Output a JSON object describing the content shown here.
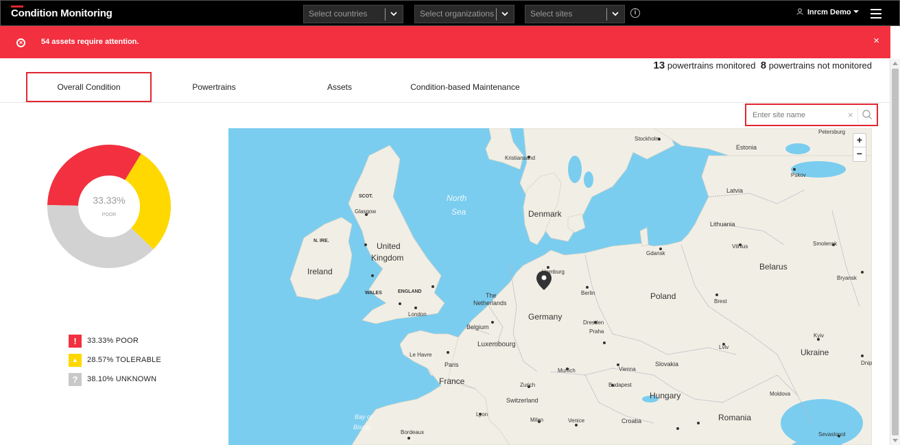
{
  "app": {
    "title": "Condition Monitoring"
  },
  "filters": {
    "countries_placeholder": "Select countries",
    "organizations_placeholder": "Select organizations",
    "sites_placeholder": "Select sites"
  },
  "user": {
    "name": "Inrcm Demo"
  },
  "alert": {
    "message": "54 assets require attention."
  },
  "summary": {
    "monitored_count": "13",
    "monitored_label": "powertrains monitored",
    "not_monitored_count": "8",
    "not_monitored_label": "powertrains not monitored"
  },
  "tabs": [
    {
      "label": "Overall Condition",
      "active": true
    },
    {
      "label": "Powertrains",
      "active": false
    },
    {
      "label": "Assets",
      "active": false
    },
    {
      "label": "Condition-based Maintenance",
      "active": false
    }
  ],
  "search": {
    "placeholder": "Enter site name"
  },
  "donut": {
    "center_value": "33.33%",
    "center_label": "POOR",
    "segments": [
      {
        "name": "POOR",
        "percent": 33.33,
        "color": "#f2303f"
      },
      {
        "name": "TOLERABLE",
        "percent": 28.57,
        "color": "#ffd800"
      },
      {
        "name": "UNKNOWN",
        "percent": 38.1,
        "color": "#d2d2d2"
      }
    ]
  },
  "legend": [
    {
      "text": "33.33% POOR",
      "icon": "!",
      "color": "#f2303f"
    },
    {
      "text": "28.57% TOLERABLE",
      "icon": "▲",
      "color": "#ffd800"
    },
    {
      "text": "38.10% UNKNOWN",
      "icon": "?",
      "color": "#c8c8c8"
    }
  ],
  "map": {
    "zoom_in": "+",
    "zoom_out": "−",
    "labels": {
      "stockholm": "Stockholm",
      "estonia": "Estonia",
      "petersburg": "Petersburg",
      "kristiansand": "Kristiansand",
      "pskov": "Pskov",
      "scot": "SCOT.",
      "glasgow": "Glasgow",
      "north_sea_1": "North",
      "north_sea_2": "Sea",
      "denmark": "Denmark",
      "latvia": "Latvia",
      "lithuania": "Lithuania",
      "n_ire": "N. IRE.",
      "uk_1": "United",
      "uk_2": "Kingdom",
      "gdansk": "Gdansk",
      "vilnius": "Vilnius",
      "smolensk": "Smolensk",
      "ireland": "Ireland",
      "hamburg": "Hamburg",
      "belarus": "Belarus",
      "bryansk": "Bryansk",
      "wales": "WALES",
      "england": "ENGLAND",
      "berlin": "Berlin",
      "poland": "Poland",
      "the": "The",
      "netherlands": "Netherlands",
      "london": "London",
      "brest": "Brest",
      "germany": "Germany",
      "belgium": "Belgium",
      "dresden": "Dresden",
      "praha": "Praha",
      "luxembourg": "Luxembourg",
      "kyiv": "Kyiv",
      "le_havre": "Le Havre",
      "lviv": "Lviv",
      "paris": "Paris",
      "ukraine": "Ukraine",
      "munich": "Munich",
      "vienna": "Vienna",
      "slovakia": "Slovakia",
      "dnipro": "Dnipro",
      "france": "France",
      "zurich": "Zurich",
      "budapest": "Budapest",
      "switzerland": "Switzerland",
      "hungary": "Hungary",
      "moldova": "Moldova",
      "bay_1": "Bay of",
      "bay_2": "Biscay",
      "lyon": "Lyon",
      "milan": "Milan",
      "venice": "Venice",
      "croatia": "Croatia",
      "romania": "Romania",
      "bordeaux": "Bordeaux",
      "sevastopol": "Sevastopol"
    }
  }
}
